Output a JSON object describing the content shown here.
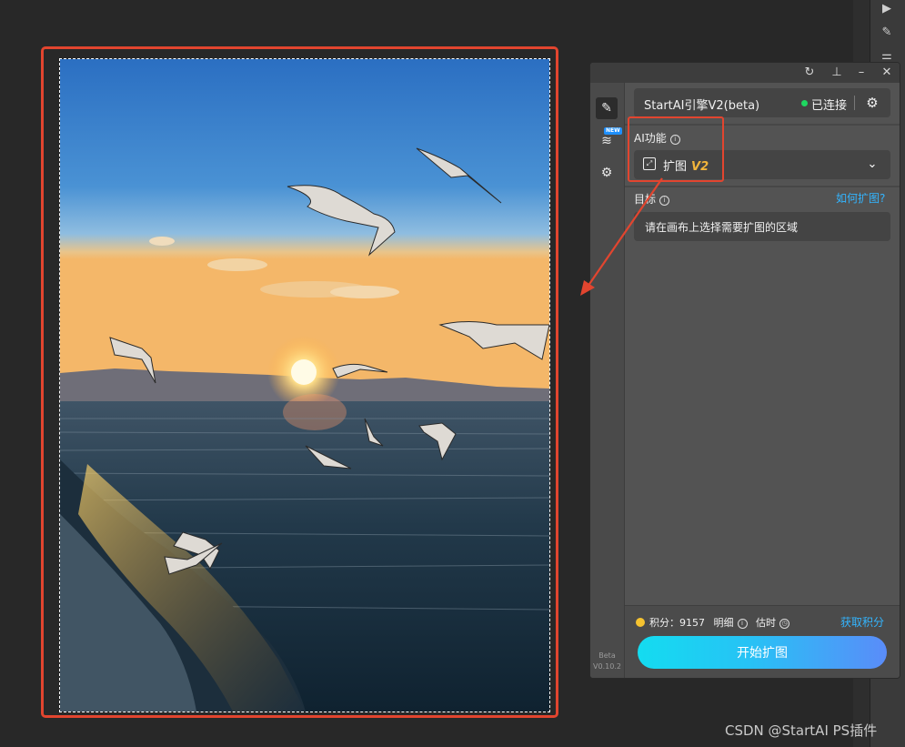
{
  "panel": {
    "titlebar": {
      "icons": [
        "refresh-icon",
        "pin-icon",
        "minimize-icon",
        "close-icon"
      ]
    },
    "engine": {
      "name": "StartAI引擎V2(beta)",
      "status": "已连接",
      "status_color": "#1ed760"
    },
    "ai_function": {
      "label": "AI功能",
      "info_symbol": "i",
      "selected": "扩图",
      "version_tag": "V2",
      "version_color": "#f2b53b"
    },
    "target": {
      "label": "目标",
      "info_symbol": "i",
      "help_link": "如何扩图?",
      "hint": "请在画布上选择需要扩图的区域"
    },
    "footer": {
      "points_label": "积分：",
      "points_value": "9157",
      "detail_label": "明细",
      "estimate_label": "估时",
      "get_points": "获取积分",
      "start_button": "开始扩图"
    },
    "nav": {
      "new_badge": "NEW",
      "beta_label": "Beta",
      "version": "V0.10.2"
    },
    "accent_color": "#33b5ff"
  },
  "canvas": {
    "image": "sunset-seagulls-lake-photo",
    "annotation_color": "#e2452f"
  },
  "watermark": "CSDN @StartAI PS插件"
}
